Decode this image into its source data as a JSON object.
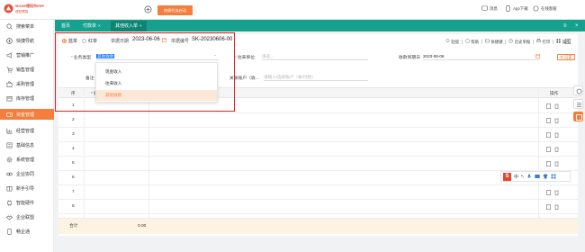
{
  "app": {
    "logo_text": "MODE德阳市ERP",
    "logo_sub": "德阳蜀智",
    "shortcut_button": "快捷任务启动",
    "user_menu": [
      "消息",
      "App下载",
      "在线客服"
    ]
  },
  "sidebar": {
    "items": [
      {
        "label": "搜索菜单",
        "icon": "search-icon"
      },
      {
        "label": "快捷导航",
        "icon": "compass-icon"
      },
      {
        "label": "营销推广",
        "icon": "megaphone-icon"
      },
      {
        "label": "销售管理",
        "icon": "cart-icon"
      },
      {
        "label": "采购管理",
        "icon": "bag-icon"
      },
      {
        "label": "库存管理",
        "icon": "box-icon"
      },
      {
        "label": "资金管理",
        "icon": "wallet-icon",
        "active": true
      },
      {
        "label": "经营管理",
        "icon": "chart-icon"
      },
      {
        "label": "基础信息",
        "icon": "info-icon"
      },
      {
        "label": "系统管理",
        "icon": "gear-icon"
      },
      {
        "label": "企业协同",
        "icon": "link-icon"
      },
      {
        "label": "新手引导",
        "icon": "guide-icon"
      },
      {
        "label": "智能硬件",
        "icon": "chip-icon"
      },
      {
        "label": "企业联盟",
        "icon": "handshake-icon"
      },
      {
        "label": "畅企通",
        "icon": "mobile-icon"
      }
    ]
  },
  "tabs": [
    {
      "label": "首页",
      "closable": false
    },
    {
      "label": "付款单",
      "closable": true
    },
    {
      "label": "其他收入单",
      "closable": true,
      "active": true
    }
  ],
  "form": {
    "type_options": [
      "蓝单",
      "红单"
    ],
    "doc_date_label": "单据日期",
    "doc_date": "2023-06-06",
    "doc_no_label": "单据编号",
    "doc_no": "SK-20230606-00",
    "toolbar": [
      "轻提",
      "帮助",
      "快捷键",
      "历史单据",
      "打印",
      "操作"
    ],
    "biz_type_label": "业务类型",
    "biz_type_value": "其他收款",
    "counterparty_label": "往来单位",
    "counterparty_placeholder": "请选...",
    "receipt_date_label": "收款到期日",
    "receipt_date": "2023-06-06",
    "settings_btn": "设置",
    "remark_label": "备注",
    "settle_account_label": "关联账户（收...",
    "settle_account_placeholder": "请输入/选择账户（收/付款）",
    "dropdown_options": [
      "现金收入",
      "往来收入",
      "其他收款"
    ],
    "dropdown_selected": 2
  },
  "table": {
    "columns": [
      "序",
      "* 收入类别",
      "操作"
    ],
    "row_numbers": [
      "1",
      "2",
      "3",
      "4",
      "5",
      "6",
      "7",
      "8"
    ],
    "total_label": "合计",
    "total_amount": "0.00"
  },
  "colors": {
    "accent": "#f57e3c",
    "tabbar": "#16a08e",
    "highlight_box": "#e02020"
  }
}
